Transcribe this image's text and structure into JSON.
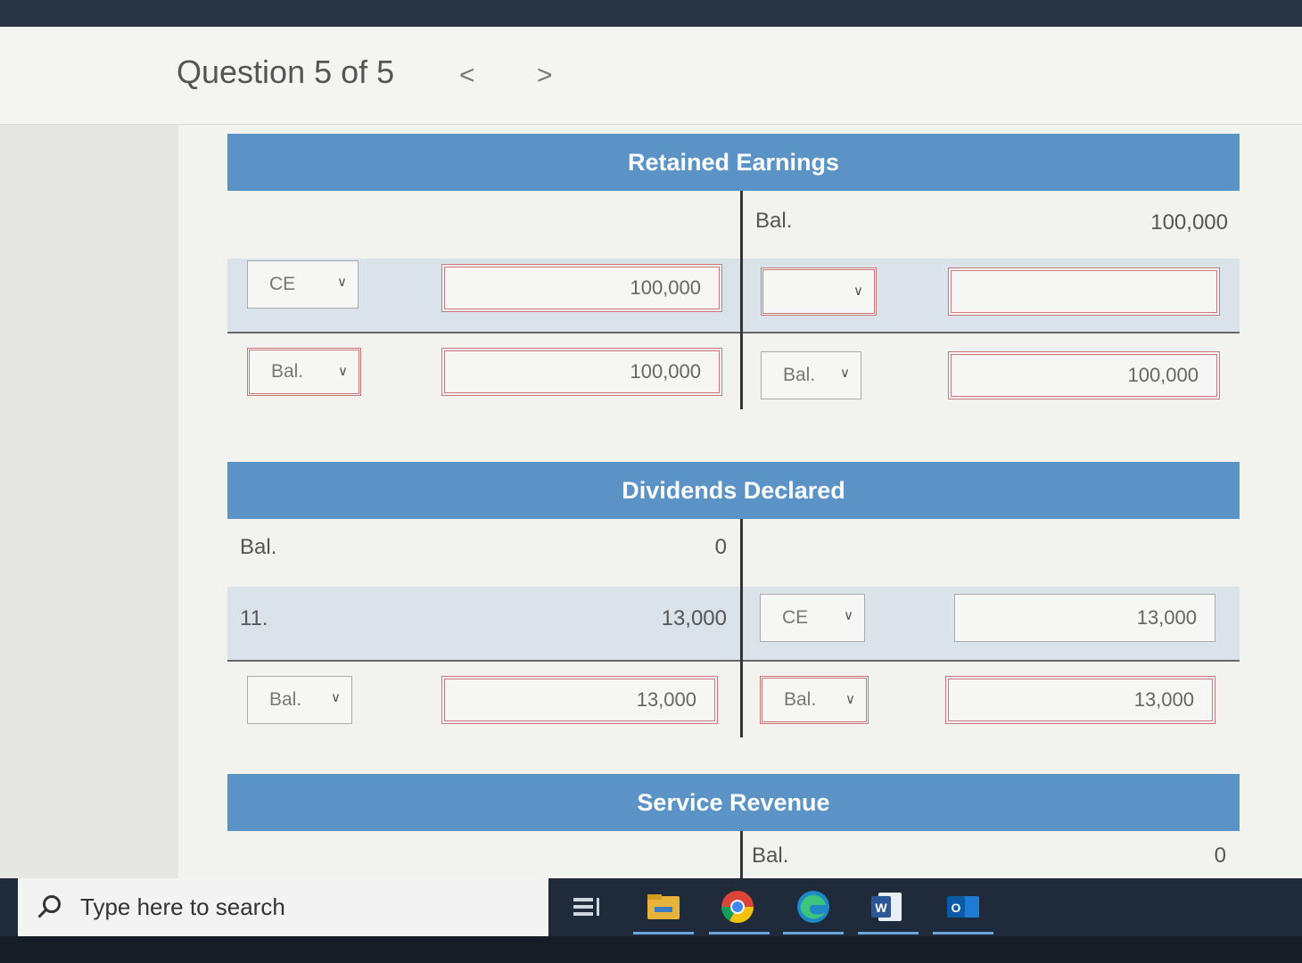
{
  "header": {
    "question_label": "Question 5 of 5",
    "prev_glyph": "<",
    "next_glyph": ">"
  },
  "retained_earnings": {
    "title": "Retained Earnings",
    "row1": {
      "right_label": "Bal.",
      "right_amount": "100,000"
    },
    "row2": {
      "left_select": "CE",
      "left_amount": "100,000",
      "right_select": "",
      "right_amount": ""
    },
    "row3": {
      "left_select": "Bal.",
      "left_amount": "100,000",
      "right_select": "Bal.",
      "right_amount": "100,000"
    }
  },
  "dividends_declared": {
    "title": "Dividends Declared",
    "row1": {
      "left_label": "Bal.",
      "left_amount": "0"
    },
    "row2": {
      "left_label": "11.",
      "left_amount": "13,000",
      "right_select": "CE",
      "right_amount": "13,000"
    },
    "row3": {
      "left_select": "Bal.",
      "left_amount": "13,000",
      "right_select": "Bal.",
      "right_amount": "13,000"
    }
  },
  "service_revenue": {
    "title": "Service Revenue",
    "row1": {
      "right_label": "Bal.",
      "right_amount": "0"
    }
  },
  "taskbar": {
    "search_placeholder": "Type here to search",
    "apps": [
      "task-view-icon",
      "file-explorer-icon",
      "chrome-icon",
      "edge-icon",
      "word-icon",
      "outlook-icon"
    ]
  },
  "colors": {
    "header_blue": "#5b93c6",
    "row_shade": "#dbe3ea",
    "error_border": "#c8767a"
  }
}
